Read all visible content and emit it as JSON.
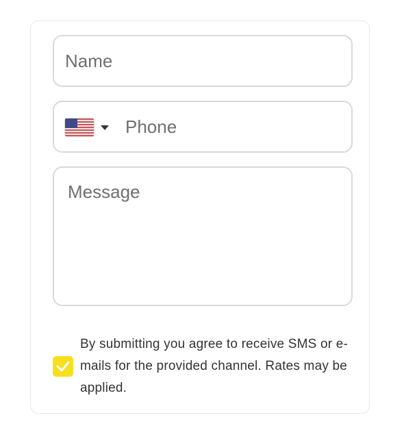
{
  "form": {
    "name": {
      "placeholder": "Name",
      "value": ""
    },
    "phone": {
      "placeholder": "Phone",
      "value": "",
      "country_flag": "us-flag-icon"
    },
    "message": {
      "placeholder": "Message",
      "value": ""
    },
    "consent": {
      "checked": true,
      "text": "By submitting you agree to receive SMS or e-mails for the provided channel. Rates may be applied."
    }
  },
  "colors": {
    "checkbox_accent": "#f7df1e",
    "field_border": "#d9d9d9",
    "placeholder": "#6f6f6f"
  }
}
